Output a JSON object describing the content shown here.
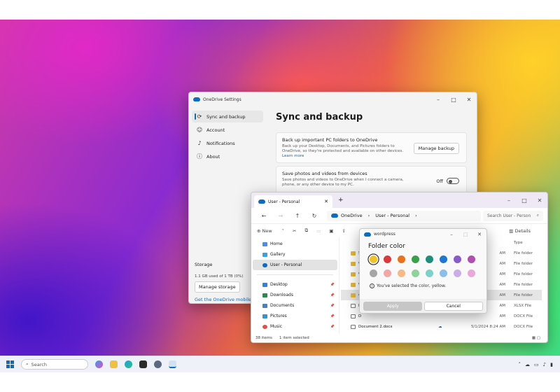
{
  "settings": {
    "title": "OneDrive Settings",
    "nav": [
      {
        "label": "Sync and backup",
        "icon": "sync-icon"
      },
      {
        "label": "Account",
        "icon": "person-icon"
      },
      {
        "label": "Notifications",
        "icon": "bell-icon"
      },
      {
        "label": "About",
        "icon": "info-icon"
      }
    ],
    "heading": "Sync and backup",
    "backup": {
      "title": "Back up important PC folders to OneDrive",
      "desc": "Back up your Desktop, Documents, and Pictures folders to OneDrive, so they're protected and available on other devices.",
      "link": "Learn more",
      "button": "Manage backup"
    },
    "photos": {
      "title": "Save photos and videos from devices",
      "desc": "Save photos and videos to OneDrive when I connect a camera, phone, or any other device to my PC.",
      "state": "Off"
    },
    "storage": {
      "label": "Storage",
      "used": "1.1 GB used of 1 TB (0%)",
      "button": "Manage storage",
      "link": "Get the OneDrive mobile"
    }
  },
  "explorer": {
    "tab": "User - Personal",
    "breadcrumb": [
      "OneDrive",
      "User - Personal"
    ],
    "search_placeholder": "Search User - Person",
    "new_label": "New",
    "details_label": "Details",
    "nav": [
      {
        "label": "Home",
        "color": "#4a8fe0"
      },
      {
        "label": "Gallery",
        "color": "#3aa0e0"
      },
      {
        "label": "User - Personal",
        "color": "#0f6cbd"
      },
      {
        "label": "Desktop",
        "color": "#3a7fd0"
      },
      {
        "label": "Downloads",
        "color": "#2a8a4a"
      },
      {
        "label": "Documents",
        "color": "#4a7fc0"
      },
      {
        "label": "Pictures",
        "color": "#3a90d0"
      },
      {
        "label": "Music",
        "color": "#e05050"
      }
    ],
    "columns": [
      "Type"
    ],
    "rows": [
      {
        "name": "S",
        "date": "",
        "type": "File folder"
      },
      {
        "name": "W",
        "date": "",
        "type": "File folder"
      },
      {
        "name": "W",
        "date": "",
        "type": "File folder"
      },
      {
        "name": "W",
        "date": "",
        "type": "File folder"
      },
      {
        "name": "w",
        "date": "",
        "type": "File folder"
      },
      {
        "name": "B",
        "date": "",
        "type": "XLSX File"
      },
      {
        "name": "D",
        "date": "",
        "type": "DOCX File"
      },
      {
        "name": "Document 2.docx",
        "date": "5/1/2024 8:24 AM",
        "type": "DOCX File"
      }
    ],
    "row_dates": [
      "AM",
      "AM",
      "AM",
      "AM",
      "AM",
      "AM",
      "AM"
    ],
    "status": {
      "count": "38 items",
      "selected": "1 item selected"
    }
  },
  "dialog": {
    "title": "wordpress",
    "heading": "Folder color",
    "colors_row1": [
      "#f2c12e",
      "#d73b3b",
      "#e8731c",
      "#3aa04c",
      "#1f8f7c",
      "#1e78d0",
      "#8a5cc9",
      "#b04fb0"
    ],
    "colors_row2": [
      "#a6a6a6",
      "#f2a8a8",
      "#f5b98a",
      "#8fd39a",
      "#7fd0c6",
      "#8bbfe8",
      "#c9aee8",
      "#e8a8d8"
    ],
    "info": "You've selected the color, yellow.",
    "apply": "Apply",
    "cancel": "Cancel"
  },
  "taskbar": {
    "search": "Search"
  }
}
